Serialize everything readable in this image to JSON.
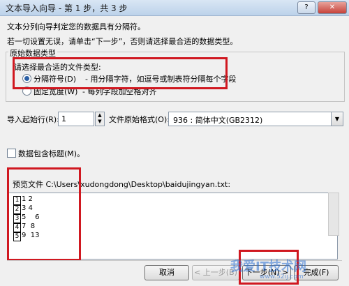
{
  "window": {
    "title": "文本导入向导 - 第 1 步，共 3 步",
    "help": "?",
    "close": "✕"
  },
  "intro": {
    "line1": "文本分列向导判定您的数据具有分隔符。",
    "line2": "若一切设置无误，请单击“下一步”，否则请选择最合适的数据类型。"
  },
  "datatype_group": {
    "title": "原始数据类型",
    "prompt": "请选择最合适的文件类型:",
    "option1_label": "分隔符号(D)",
    "option1_desc": "- 用分隔字符，如逗号或制表符分隔每个字段",
    "option2_label": "固定宽度(W)",
    "option2_desc": "- 每列字段加空格对齐"
  },
  "import": {
    "start_row_label": "导入起始行(R):",
    "start_row_value": "1",
    "origin_label": "文件原始格式(O):",
    "origin_value": "936 : 简体中文(GB2312)"
  },
  "headers_check": {
    "label": "数据包含标题(M)。"
  },
  "preview": {
    "label": "预览文件 C:\\Users\\xudongdong\\Desktop\\baidujingyan.txt:",
    "rows": [
      {
        "num": "1",
        "text": "1 2"
      },
      {
        "num": "2",
        "text": "3 4"
      },
      {
        "num": "3",
        "text": "5    6"
      },
      {
        "num": "4",
        "text": "7  8"
      },
      {
        "num": "5",
        "text": "9  13"
      }
    ]
  },
  "buttons": {
    "cancel": "取消",
    "back": "< 上一步(B)",
    "next": "下一步(N) >",
    "finish": "完成(F)"
  },
  "watermark": {
    "text": "我爱IT技术网",
    "sub": "www.52ij.com"
  }
}
